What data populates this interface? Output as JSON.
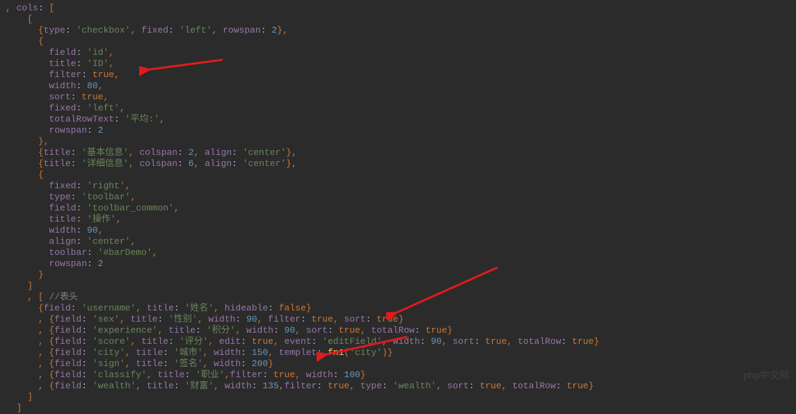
{
  "lines": [
    [
      [
        "t-punc",
        ", "
      ],
      [
        "t-key",
        "cols"
      ],
      [
        "t-plain",
        ": "
      ],
      [
        "t-punc",
        "["
      ]
    ],
    [
      [
        "t-plain",
        "    "
      ],
      [
        "t-punc",
        "["
      ]
    ],
    [
      [
        "t-plain",
        "      "
      ],
      [
        "t-punc",
        "{"
      ],
      [
        "t-key",
        "type"
      ],
      [
        "t-plain",
        ": "
      ],
      [
        "t-str",
        "'checkbox'"
      ],
      [
        "t-comma",
        ", "
      ],
      [
        "t-key",
        "fixed"
      ],
      [
        "t-plain",
        ": "
      ],
      [
        "t-str",
        "'left'"
      ],
      [
        "t-comma",
        ", "
      ],
      [
        "t-key",
        "rowspan"
      ],
      [
        "t-plain",
        ": "
      ],
      [
        "t-num",
        "2"
      ],
      [
        "t-punc",
        "},"
      ]
    ],
    [
      [
        "t-plain",
        "      "
      ],
      [
        "t-punc",
        "{"
      ]
    ],
    [
      [
        "t-plain",
        "        "
      ],
      [
        "t-key",
        "field"
      ],
      [
        "t-plain",
        ": "
      ],
      [
        "t-str",
        "'id'"
      ],
      [
        "t-comma",
        ","
      ]
    ],
    [
      [
        "t-plain",
        "        "
      ],
      [
        "t-key",
        "title"
      ],
      [
        "t-plain",
        ": "
      ],
      [
        "t-str",
        "'ID'"
      ],
      [
        "t-comma",
        ","
      ]
    ],
    [
      [
        "t-plain",
        "        "
      ],
      [
        "t-key",
        "filter"
      ],
      [
        "t-plain",
        ": "
      ],
      [
        "t-bool",
        "true"
      ],
      [
        "t-comma",
        ","
      ]
    ],
    [
      [
        "t-plain",
        "        "
      ],
      [
        "t-key",
        "width"
      ],
      [
        "t-plain",
        ": "
      ],
      [
        "t-num",
        "80"
      ],
      [
        "t-comma",
        ","
      ]
    ],
    [
      [
        "t-plain",
        "        "
      ],
      [
        "t-key",
        "sort"
      ],
      [
        "t-plain",
        ": "
      ],
      [
        "t-bool",
        "true"
      ],
      [
        "t-comma",
        ","
      ]
    ],
    [
      [
        "t-plain",
        "        "
      ],
      [
        "t-key",
        "fixed"
      ],
      [
        "t-plain",
        ": "
      ],
      [
        "t-str",
        "'left'"
      ],
      [
        "t-comma",
        ","
      ]
    ],
    [
      [
        "t-plain",
        "        "
      ],
      [
        "t-key",
        "totalRowText"
      ],
      [
        "t-plain",
        ": "
      ],
      [
        "t-str",
        "'平均:'"
      ],
      [
        "t-comma",
        ","
      ]
    ],
    [
      [
        "t-plain",
        "        "
      ],
      [
        "t-key",
        "rowspan"
      ],
      [
        "t-plain",
        ": "
      ],
      [
        "t-num",
        "2"
      ]
    ],
    [
      [
        "t-plain",
        "      "
      ],
      [
        "t-punc",
        "},"
      ]
    ],
    [
      [
        "t-plain",
        "      "
      ],
      [
        "t-punc",
        "{"
      ],
      [
        "t-key",
        "title"
      ],
      [
        "t-plain",
        ": "
      ],
      [
        "t-str",
        "'基本信息'"
      ],
      [
        "t-comma",
        ", "
      ],
      [
        "t-key",
        "colspan"
      ],
      [
        "t-plain",
        ": "
      ],
      [
        "t-num",
        "2"
      ],
      [
        "t-comma",
        ", "
      ],
      [
        "t-key",
        "align"
      ],
      [
        "t-plain",
        ": "
      ],
      [
        "t-str",
        "'center'"
      ],
      [
        "t-punc",
        "},"
      ]
    ],
    [
      [
        "t-plain",
        "      "
      ],
      [
        "t-punc",
        "{"
      ],
      [
        "t-key",
        "title"
      ],
      [
        "t-plain",
        ": "
      ],
      [
        "t-str",
        "'详细信息'"
      ],
      [
        "t-comma",
        ", "
      ],
      [
        "t-key",
        "colspan"
      ],
      [
        "t-plain",
        ": "
      ],
      [
        "t-num",
        "6"
      ],
      [
        "t-comma",
        ", "
      ],
      [
        "t-key",
        "align"
      ],
      [
        "t-plain",
        ": "
      ],
      [
        "t-str",
        "'center'"
      ],
      [
        "t-punc",
        "},"
      ]
    ],
    [
      [
        "t-plain",
        "      "
      ],
      [
        "t-punc",
        "{"
      ]
    ],
    [
      [
        "t-plain",
        "        "
      ],
      [
        "t-key",
        "fixed"
      ],
      [
        "t-plain",
        ": "
      ],
      [
        "t-str",
        "'right'"
      ],
      [
        "t-comma",
        ","
      ]
    ],
    [
      [
        "t-plain",
        "        "
      ],
      [
        "t-key",
        "type"
      ],
      [
        "t-plain",
        ": "
      ],
      [
        "t-str",
        "'toolbar'"
      ],
      [
        "t-comma",
        ","
      ]
    ],
    [
      [
        "t-plain",
        "        "
      ],
      [
        "t-key",
        "field"
      ],
      [
        "t-plain",
        ": "
      ],
      [
        "t-str",
        "'toolbar_common'"
      ],
      [
        "t-comma",
        ","
      ]
    ],
    [
      [
        "t-plain",
        "        "
      ],
      [
        "t-key",
        "title"
      ],
      [
        "t-plain",
        ": "
      ],
      [
        "t-str",
        "'操作'"
      ],
      [
        "t-comma",
        ","
      ]
    ],
    [
      [
        "t-plain",
        "        "
      ],
      [
        "t-key",
        "width"
      ],
      [
        "t-plain",
        ": "
      ],
      [
        "t-num",
        "90"
      ],
      [
        "t-comma",
        ","
      ]
    ],
    [
      [
        "t-plain",
        "        "
      ],
      [
        "t-key",
        "align"
      ],
      [
        "t-plain",
        ": "
      ],
      [
        "t-str",
        "'center'"
      ],
      [
        "t-comma",
        ","
      ]
    ],
    [
      [
        "t-plain",
        "        "
      ],
      [
        "t-key",
        "toolbar"
      ],
      [
        "t-plain",
        ": "
      ],
      [
        "t-str",
        "'#barDemo'"
      ],
      [
        "t-comma",
        ","
      ]
    ],
    [
      [
        "t-plain",
        "        "
      ],
      [
        "t-key",
        "rowspan"
      ],
      [
        "t-plain",
        ": "
      ],
      [
        "t-num",
        "2"
      ]
    ],
    [
      [
        "t-plain",
        "      "
      ],
      [
        "t-punc",
        "}"
      ]
    ],
    [
      [
        "t-plain",
        "    "
      ],
      [
        "t-punc",
        "]"
      ]
    ],
    [
      [
        "t-plain",
        "    "
      ],
      [
        "t-punc",
        ", ["
      ],
      [
        "t-plain",
        " "
      ],
      [
        "t-comment",
        "//表头"
      ]
    ],
    [
      [
        "t-plain",
        "      "
      ],
      [
        "t-punc",
        "{"
      ],
      [
        "t-key",
        "field"
      ],
      [
        "t-plain",
        ": "
      ],
      [
        "t-str",
        "'username'"
      ],
      [
        "t-comma",
        ", "
      ],
      [
        "t-key",
        "title"
      ],
      [
        "t-plain",
        ": "
      ],
      [
        "t-str",
        "'姓名'"
      ],
      [
        "t-comma",
        ", "
      ],
      [
        "t-key",
        "hideable"
      ],
      [
        "t-plain",
        ": "
      ],
      [
        "t-bool",
        "false"
      ],
      [
        "t-punc",
        "}"
      ]
    ],
    [
      [
        "t-plain",
        "      "
      ],
      [
        "t-punc",
        ", {"
      ],
      [
        "t-key",
        "field"
      ],
      [
        "t-plain",
        ": "
      ],
      [
        "t-str",
        "'sex'"
      ],
      [
        "t-comma",
        ", "
      ],
      [
        "t-key",
        "title"
      ],
      [
        "t-plain",
        ": "
      ],
      [
        "t-str",
        "'性别'"
      ],
      [
        "t-comma",
        ", "
      ],
      [
        "t-key",
        "width"
      ],
      [
        "t-plain",
        ": "
      ],
      [
        "t-num",
        "90"
      ],
      [
        "t-comma",
        ", "
      ],
      [
        "t-key",
        "filter"
      ],
      [
        "t-plain",
        ": "
      ],
      [
        "t-bool",
        "true"
      ],
      [
        "t-comma",
        ", "
      ],
      [
        "t-key",
        "sort"
      ],
      [
        "t-plain",
        ": "
      ],
      [
        "t-bool",
        "true"
      ],
      [
        "t-punc",
        "}"
      ]
    ],
    [
      [
        "t-plain",
        "      "
      ],
      [
        "t-punc",
        ", {"
      ],
      [
        "t-key",
        "field"
      ],
      [
        "t-plain",
        ": "
      ],
      [
        "t-str",
        "'experience'"
      ],
      [
        "t-comma",
        ", "
      ],
      [
        "t-key",
        "title"
      ],
      [
        "t-plain",
        ": "
      ],
      [
        "t-str",
        "'积分'"
      ],
      [
        "t-comma",
        ", "
      ],
      [
        "t-key",
        "width"
      ],
      [
        "t-plain",
        ": "
      ],
      [
        "t-num",
        "90"
      ],
      [
        "t-comma",
        ", "
      ],
      [
        "t-key",
        "sort"
      ],
      [
        "t-plain",
        ": "
      ],
      [
        "t-bool",
        "true"
      ],
      [
        "t-comma",
        ", "
      ],
      [
        "t-key",
        "totalRow"
      ],
      [
        "t-plain",
        ": "
      ],
      [
        "t-bool",
        "true"
      ],
      [
        "t-punc",
        "}"
      ]
    ],
    [
      [
        "t-plain",
        "      "
      ],
      [
        "t-punc",
        ", {"
      ],
      [
        "t-key",
        "field"
      ],
      [
        "t-plain",
        ": "
      ],
      [
        "t-str",
        "'score'"
      ],
      [
        "t-comma",
        ", "
      ],
      [
        "t-key",
        "title"
      ],
      [
        "t-plain",
        ": "
      ],
      [
        "t-str",
        "'评分'"
      ],
      [
        "t-comma",
        ", "
      ],
      [
        "t-key",
        "edit"
      ],
      [
        "t-plain",
        ": "
      ],
      [
        "t-bool",
        "true"
      ],
      [
        "t-comma",
        ", "
      ],
      [
        "t-key",
        "event"
      ],
      [
        "t-plain",
        ": "
      ],
      [
        "t-str",
        "'editField'"
      ],
      [
        "t-comma",
        ", "
      ],
      [
        "t-key",
        "width"
      ],
      [
        "t-plain",
        ": "
      ],
      [
        "t-num",
        "90"
      ],
      [
        "t-comma",
        ", "
      ],
      [
        "t-key",
        "sort"
      ],
      [
        "t-plain",
        ": "
      ],
      [
        "t-bool",
        "true"
      ],
      [
        "t-comma",
        ", "
      ],
      [
        "t-key",
        "totalRow"
      ],
      [
        "t-plain",
        ": "
      ],
      [
        "t-bool",
        "true"
      ],
      [
        "t-punc",
        "}"
      ]
    ],
    [
      [
        "t-plain",
        "      "
      ],
      [
        "t-punc",
        ", {"
      ],
      [
        "t-key",
        "field"
      ],
      [
        "t-plain",
        ": "
      ],
      [
        "t-str",
        "'city'"
      ],
      [
        "t-comma",
        ", "
      ],
      [
        "t-key",
        "title"
      ],
      [
        "t-plain",
        ": "
      ],
      [
        "t-str",
        "'城市'"
      ],
      [
        "t-comma",
        ", "
      ],
      [
        "t-key",
        "width"
      ],
      [
        "t-plain",
        ": "
      ],
      [
        "t-num",
        "150"
      ],
      [
        "t-comma",
        ", "
      ],
      [
        "t-key",
        "templet"
      ],
      [
        "t-plain",
        ": "
      ],
      [
        "t-fn",
        "fn1"
      ],
      [
        "t-punc",
        "("
      ],
      [
        "t-str",
        "'city'"
      ],
      [
        "t-punc",
        ")}"
      ]
    ],
    [
      [
        "t-plain",
        "      "
      ],
      [
        "t-punc",
        ", {"
      ],
      [
        "t-key",
        "field"
      ],
      [
        "t-plain",
        ": "
      ],
      [
        "t-str",
        "'sign'"
      ],
      [
        "t-comma",
        ", "
      ],
      [
        "t-key",
        "title"
      ],
      [
        "t-plain",
        ": "
      ],
      [
        "t-str",
        "'签名'"
      ],
      [
        "t-comma",
        ", "
      ],
      [
        "t-key",
        "width"
      ],
      [
        "t-plain",
        ": "
      ],
      [
        "t-num",
        "200"
      ],
      [
        "t-punc",
        "}"
      ]
    ],
    [
      [
        "t-plain",
        "      "
      ],
      [
        "t-punc",
        ", {"
      ],
      [
        "t-key",
        "field"
      ],
      [
        "t-plain",
        ": "
      ],
      [
        "t-str",
        "'classify'"
      ],
      [
        "t-comma",
        ", "
      ],
      [
        "t-key",
        "title"
      ],
      [
        "t-plain",
        ": "
      ],
      [
        "t-str",
        "'职业'"
      ],
      [
        "t-comma",
        ","
      ],
      [
        "t-key",
        "filter"
      ],
      [
        "t-plain",
        ": "
      ],
      [
        "t-bool",
        "true"
      ],
      [
        "t-comma",
        ", "
      ],
      [
        "t-key",
        "width"
      ],
      [
        "t-plain",
        ": "
      ],
      [
        "t-num",
        "100"
      ],
      [
        "t-punc",
        "}"
      ]
    ],
    [
      [
        "t-plain",
        "      "
      ],
      [
        "t-punc",
        ", {"
      ],
      [
        "t-key",
        "field"
      ],
      [
        "t-plain",
        ": "
      ],
      [
        "t-str",
        "'wealth'"
      ],
      [
        "t-comma",
        ", "
      ],
      [
        "t-key",
        "title"
      ],
      [
        "t-plain",
        ": "
      ],
      [
        "t-str",
        "'财富'"
      ],
      [
        "t-comma",
        ", "
      ],
      [
        "t-key",
        "width"
      ],
      [
        "t-plain",
        ": "
      ],
      [
        "t-num",
        "135"
      ],
      [
        "t-comma",
        ","
      ],
      [
        "t-key",
        "filter"
      ],
      [
        "t-plain",
        ": "
      ],
      [
        "t-bool",
        "true"
      ],
      [
        "t-comma",
        ", "
      ],
      [
        "t-key",
        "type"
      ],
      [
        "t-plain",
        ": "
      ],
      [
        "t-str",
        "'wealth'"
      ],
      [
        "t-comma",
        ", "
      ],
      [
        "t-key",
        "sort"
      ],
      [
        "t-plain",
        ": "
      ],
      [
        "t-bool",
        "true"
      ],
      [
        "t-comma",
        ", "
      ],
      [
        "t-key",
        "totalRow"
      ],
      [
        "t-plain",
        ": "
      ],
      [
        "t-bool",
        "true"
      ],
      [
        "t-punc",
        "}"
      ]
    ],
    [
      [
        "t-plain",
        "    "
      ],
      [
        "t-punc",
        "]"
      ]
    ],
    [
      [
        "t-plain",
        "  "
      ],
      [
        "t-punc",
        "]"
      ]
    ]
  ],
  "watermark": "php中文网"
}
